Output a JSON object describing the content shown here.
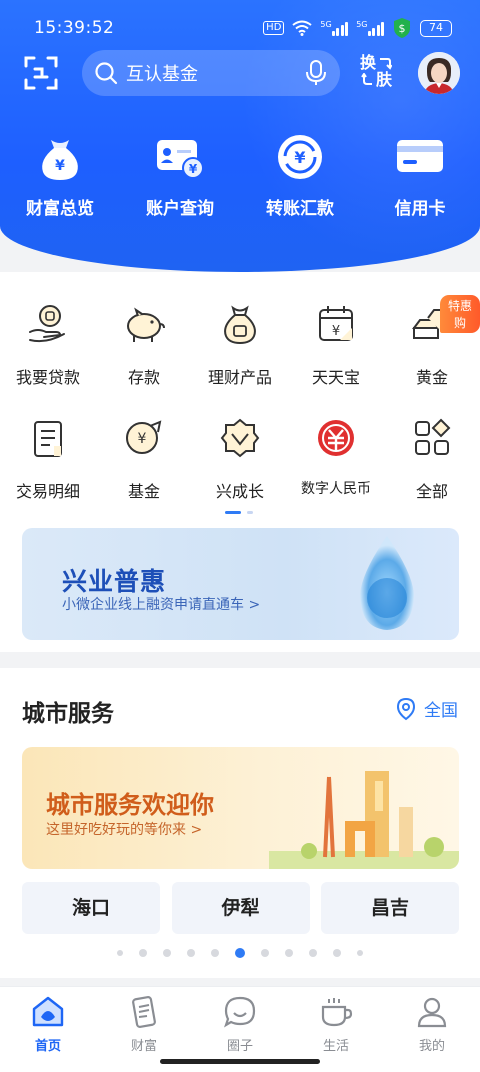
{
  "status": {
    "time": "15:39:52",
    "battery": "74",
    "net1": "5G",
    "net2": "5G",
    "hd": "HD"
  },
  "search": {
    "placeholder": "互认基金"
  },
  "header": {
    "switch_skin_line1": "换",
    "switch_skin_line2": "肤"
  },
  "quick_actions": [
    {
      "label": "财富总览",
      "icon": "money-bag-icon"
    },
    {
      "label": "账户查询",
      "icon": "account-card-icon"
    },
    {
      "label": "转账汇款",
      "icon": "transfer-icon"
    },
    {
      "label": "信用卡",
      "icon": "credit-card-icon"
    }
  ],
  "services": [
    {
      "label": "我要贷款",
      "icon": "loan-icon"
    },
    {
      "label": "存款",
      "icon": "piggy-bank-icon"
    },
    {
      "label": "理财产品",
      "icon": "wealth-bag-icon"
    },
    {
      "label": "天天宝",
      "icon": "calendar-yuan-icon"
    },
    {
      "label": "黄金",
      "icon": "gold-bar-icon",
      "badge": "特惠购"
    },
    {
      "label": "交易明细",
      "icon": "receipt-icon"
    },
    {
      "label": "基金",
      "icon": "fund-icon"
    },
    {
      "label": "兴成长",
      "icon": "growth-icon"
    },
    {
      "label": "数字人民币",
      "icon": "digital-rmb-icon"
    },
    {
      "label": "全部",
      "icon": "all-apps-icon"
    }
  ],
  "promo_banner": {
    "title": "兴业普惠",
    "subtitle": "小微企业线上融资申请直通车 >"
  },
  "city_service": {
    "title": "城市服务",
    "location": "全国",
    "banner_title": "城市服务欢迎你",
    "banner_subtitle": "这里好吃好玩的等你来 >",
    "cities": [
      "海口",
      "伊犁",
      "昌吉"
    ]
  },
  "tabbar": [
    {
      "label": "首页",
      "icon": "home-icon",
      "active": true
    },
    {
      "label": "财富",
      "icon": "wealth-icon"
    },
    {
      "label": "圈子",
      "icon": "chat-circle-icon"
    },
    {
      "label": "生活",
      "icon": "cup-icon"
    },
    {
      "label": "我的",
      "icon": "profile-icon"
    }
  ],
  "colors": {
    "brand": "#1e5fff",
    "accent": "#2f7bf5",
    "badge": "#ff6a2c"
  }
}
